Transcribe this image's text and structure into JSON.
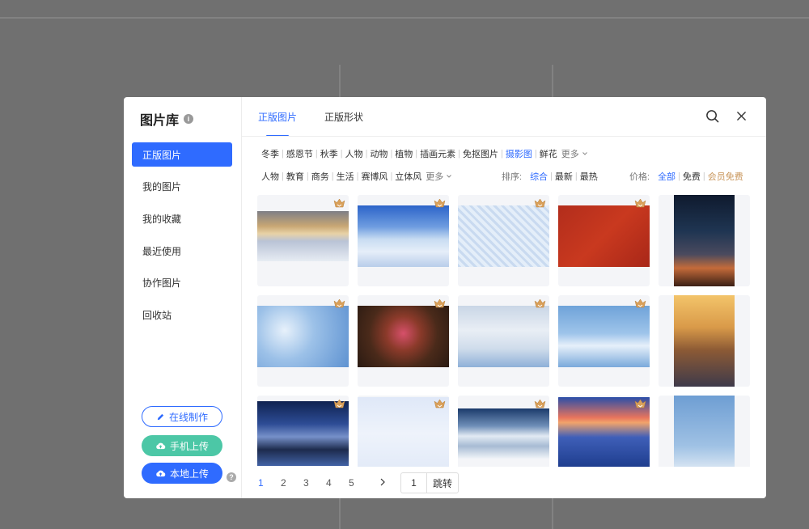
{
  "title": "图片库",
  "sidebar": {
    "items": [
      {
        "label": "正版图片",
        "active": true
      },
      {
        "label": "我的图片"
      },
      {
        "label": "我的收藏"
      },
      {
        "label": "最近使用"
      },
      {
        "label": "协作图片"
      },
      {
        "label": "回收站"
      }
    ],
    "btn_online": "在线制作",
    "btn_mobile": "手机上传",
    "btn_local": "本地上传"
  },
  "tabs": [
    {
      "label": "正版图片",
      "active": true
    },
    {
      "label": "正版形状"
    }
  ],
  "filters": {
    "row1": [
      "冬季",
      "感恩节",
      "秋季",
      "人物",
      "动物",
      "植物",
      "插画元素",
      "免抠图片",
      "摄影图",
      "鲜花"
    ],
    "row1_active": "摄影图",
    "row2": [
      "人物",
      "教育",
      "商务",
      "生活",
      "赛博风",
      "立体风"
    ],
    "more_label": "更多",
    "sort_label": "排序:",
    "sort": [
      "综合",
      "最新",
      "最热"
    ],
    "sort_active": "综合",
    "price_label": "价格:",
    "price": [
      "全部",
      "免费",
      "会员免费"
    ],
    "price_active": "全部"
  },
  "images": [
    {
      "name": "winter-sunset-trees",
      "scheme": "sunset"
    },
    {
      "name": "snow-field-blue-sky",
      "scheme": "bluefield"
    },
    {
      "name": "frost-texture",
      "scheme": "frost"
    },
    {
      "name": "snowy-branch-red-wall",
      "scheme": "redwall"
    },
    {
      "name": "milky-way-pier",
      "scheme": "milkyway"
    },
    {
      "name": "ice-crystal-blue",
      "scheme": "ice"
    },
    {
      "name": "red-flower-macro",
      "scheme": "flower"
    },
    {
      "name": "crane-snow-forest",
      "scheme": "crane"
    },
    {
      "name": "snowflake-drift",
      "scheme": "snowflake"
    },
    {
      "name": "children-beach-sunset",
      "scheme": "beach"
    },
    {
      "name": "starry-mountains-lake",
      "scheme": "starlake"
    },
    {
      "name": "white-snow-surface",
      "scheme": "snow"
    },
    {
      "name": "snow-mountain-lake",
      "scheme": "mountain"
    },
    {
      "name": "river-snow-sunset",
      "scheme": "river"
    },
    {
      "name": "blue-sky-portrait",
      "scheme": "sky"
    }
  ],
  "pagination": {
    "pages": [
      "1",
      "2",
      "3",
      "4",
      "5"
    ],
    "current": "1",
    "next_icon": "chevron-right-icon",
    "input_value": "1",
    "jump_label": "跳转"
  },
  "colors": {
    "accent": "#2f6bff",
    "mobile_button": "#4cc7a6",
    "vip_gold": "#c8955a"
  }
}
